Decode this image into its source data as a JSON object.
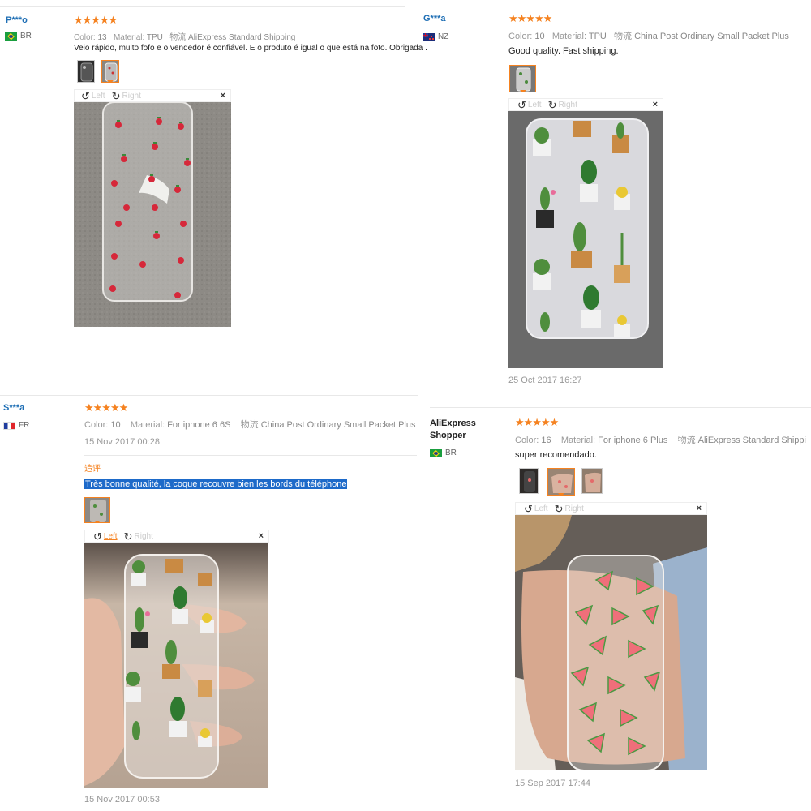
{
  "reviews": [
    {
      "user": "P***o",
      "country": "BR",
      "stars": "★★★★★",
      "color_label": "Color:",
      "color_value": "13",
      "material_label": "Material:",
      "material_value": "TPU",
      "shipping_label": "物流",
      "shipping_value": "AliExpress Standard Shipping",
      "text": "Veio rápido, muito fofo e o vendedor é confiável. E o produto é igual o que está na foto. Obrigada .",
      "left_label": "Left",
      "right_label": "Right",
      "close": "×"
    },
    {
      "user": "G***a",
      "country": "NZ",
      "stars": "★★★★★",
      "color_label": "Color:",
      "color_value": "10",
      "material_label": "Material:",
      "material_value": "TPU",
      "shipping_label": "物流",
      "shipping_value": "China Post Ordinary Small Packet Plus",
      "text": "Good quality. Fast shipping.",
      "left_label": "Left",
      "right_label": "Right",
      "close": "×",
      "date": "25 Oct 2017 16:27"
    },
    {
      "user": "S***a",
      "country": "FR",
      "stars": "★★★★★",
      "color_label": "Color:",
      "color_value": "10",
      "material_label": "Material:",
      "material_value": "For iphone 6 6S",
      "shipping_label": "物流",
      "shipping_value": "China Post Ordinary Small Packet Plus",
      "date": "15 Nov 2017 00:28",
      "additional_label": "追评",
      "text": "Très bonne qualité, la coque recouvre bien les bords du téléphone",
      "left_label": "Left",
      "right_label": "Right",
      "close": "×",
      "date2": "15 Nov 2017 00:53"
    },
    {
      "user": "AliExpress Shopper",
      "country": "BR",
      "stars": "★★★★★",
      "color_label": "Color:",
      "color_value": "16",
      "material_label": "Material:",
      "material_value": "For iphone 6 Plus",
      "shipping_label": "物流",
      "shipping_value": "AliExpress Standard Shippi",
      "text": "super recomendado.",
      "left_label": "Left",
      "right_label": "Right",
      "close": "×",
      "date": "15 Sep 2017 17:44"
    }
  ],
  "colors": {
    "accent": "#f58220",
    "username": "#1f6fb5",
    "highlight": "#1d6ac9"
  }
}
